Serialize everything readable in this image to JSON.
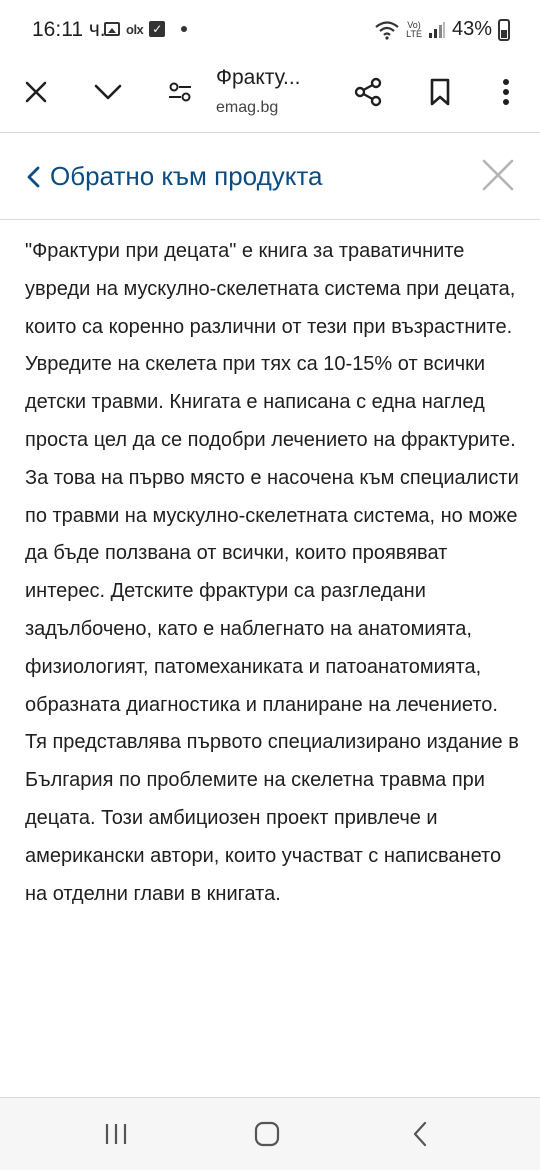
{
  "status_bar": {
    "time": "16:11 ч.",
    "battery": "43%",
    "network_label_top": "Vo)",
    "network_label_bottom": "LTE"
  },
  "toolbar": {
    "title": "Фракту...",
    "url": "emag.bg"
  },
  "page": {
    "back_label": "Обратно към продукта",
    "description": "\"Фрактури при децата\" е книга за траватичните увреди на мускулно-скелетната система при децата, които са коренно различни от тези при възрастните. Увредите на скелета при тях са 10-15% от всички детски травми. Книгата е написана с една наглед проста цел да се подобри лечението на фрактурите. За това на първо място е насочена към специалисти по травми на мускулно-скелетната система, но може да бъде ползвана от всички, които проявяват интерес. Детските фрактури са разгледани задълбочено, като е наблегнато на анатомията, физиологият, патомеханиката и патоанатомията, образната диагностика и планиране на лечението. Тя представлява първото специализирано издание в България по проблемите на скелетна травма при децата. Този амбициозен проект привлече и американски автори, които участват с написването на отделни глави в книгата."
  },
  "colors": {
    "link": "#0b4d82",
    "text": "#1f1f1f",
    "close_icon": "#b5b5b5"
  }
}
